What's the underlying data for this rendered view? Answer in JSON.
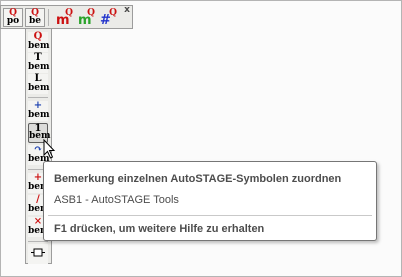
{
  "horizontal_toolbar": {
    "buttons": [
      {
        "top": "Q",
        "bottom": "po",
        "icon": "po-q-icon"
      },
      {
        "top": "Q",
        "bottom": "be",
        "icon": "be-q-icon"
      },
      {
        "glyph": "m",
        "sup": "Q",
        "color": "#cc1111",
        "icon": "m-q-red-icon"
      },
      {
        "glyph": "m",
        "sup": "Q",
        "color": "#2aa32a",
        "icon": "m-q-green-icon"
      },
      {
        "glyph": "#",
        "sup": "Q",
        "color": "#2233cc",
        "icon": "hash-q-icon"
      }
    ],
    "close": "x"
  },
  "vertical_toolbar": {
    "buttons": [
      {
        "top": "Q",
        "label": "bem",
        "top_color": "#cc1111"
      },
      {
        "top": "T",
        "label": "bem",
        "top_color": "#000000"
      },
      {
        "top": "L",
        "label": "bem",
        "top_color": "#000000"
      },
      {
        "top": "+",
        "label": "bem",
        "top_color": "#1a3fb0"
      },
      {
        "top": "1",
        "label": "bem",
        "top_color": "#000000"
      },
      {
        "top": "↷",
        "label": "bem",
        "top_color": "#1a3fb0"
      },
      {
        "top": "+",
        "label": "bem",
        "top_color": "#cc1111"
      },
      {
        "top": "/",
        "label": "bem",
        "top_color": "#cc1111"
      },
      {
        "top": "×",
        "label": "bem",
        "top_color": "#cc1111"
      }
    ]
  },
  "tooltip": {
    "title": "Bemerkung einzelnen AutoSTAGE-Symbolen zuordnen",
    "subtitle": "ASB1 - AutoSTAGE Tools",
    "help": "F1 drücken, um weitere Hilfe zu erhalten"
  },
  "colors": {
    "toolbar_bg": "#ebebe8",
    "tooltip_text": "#4d4d4d"
  }
}
